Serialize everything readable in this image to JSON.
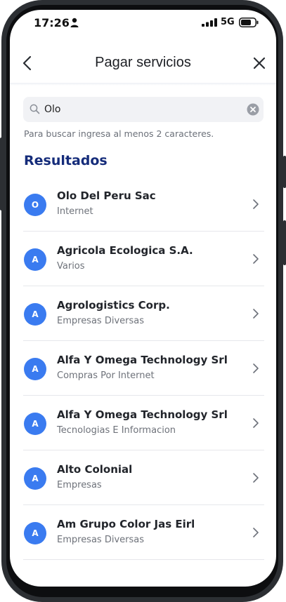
{
  "status_bar": {
    "time": "17:26",
    "network": "5G",
    "icons": [
      "person-icon",
      "signal-icon",
      "battery-icon"
    ]
  },
  "nav": {
    "title": "Pagar servicios",
    "back_icon": "chevron-left-icon",
    "close_icon": "close-icon"
  },
  "search": {
    "value": "Olo",
    "hint": "Para buscar ingresa al menos 2 caracteres.",
    "icon": "search-icon",
    "clear_icon": "clear-icon"
  },
  "results": {
    "title": "Resultados",
    "items": [
      {
        "initial": "O",
        "name": "Olo Del Peru Sac",
        "category": "Internet"
      },
      {
        "initial": "A",
        "name": "Agricola Ecologica S.A.",
        "category": "Varios"
      },
      {
        "initial": "A",
        "name": "Agrologistics Corp.",
        "category": "Empresas Diversas"
      },
      {
        "initial": "A",
        "name": "Alfa Y Omega Technology Srl",
        "category": "Compras Por Internet"
      },
      {
        "initial": "A",
        "name": "Alfa Y Omega Technology Srl",
        "category": "Tecnologias E Informacion"
      },
      {
        "initial": "A",
        "name": "Alto Colonial",
        "category": "Empresas"
      },
      {
        "initial": "A",
        "name": "Am Grupo Color Jas Eirl",
        "category": "Empresas Diversas"
      }
    ]
  },
  "colors": {
    "accent": "#3a7bf0",
    "heading": "#152c7a",
    "frame": "#2c2f33"
  }
}
